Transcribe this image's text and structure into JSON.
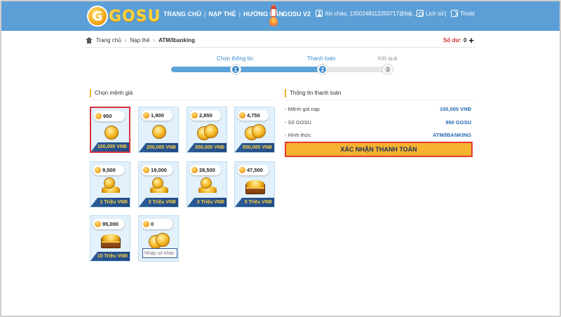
{
  "header": {
    "logo_text": "GOSU",
    "logo_letter": "G",
    "nav": [
      "TRANG CHỦ",
      "NẠP THẺ",
      "HƯỚNG DẪN"
    ],
    "nav_separator": "|",
    "v2_label": "GOSU V2",
    "greeting": "Xin chào, 1350248112250717@fac...",
    "history": "Lịch sử",
    "logout": "Thoát",
    "separator": "|"
  },
  "breadcrumb": {
    "items": [
      "Trang chủ",
      "Nạp thẻ",
      "ATM/Ibanking"
    ],
    "chevron": "›"
  },
  "balance": {
    "label": "Số dư:",
    "value": "0",
    "add": "+"
  },
  "steps": [
    {
      "label": "Chọn thông tin",
      "number": "1",
      "state": "active"
    },
    {
      "label": "Thanh toán",
      "number": "2",
      "state": "active"
    },
    {
      "label": "Kết quả",
      "number": "3",
      "state": "inactive"
    }
  ],
  "progress_fraction": 0.69,
  "denominations": {
    "title": "Chọn mệnh giá",
    "cards": [
      {
        "amount": "950",
        "price": "100,000 VNĐ",
        "art": "coin",
        "selected": true
      },
      {
        "amount": "1,900",
        "price": "200,000 VNĐ",
        "art": "coin"
      },
      {
        "amount": "2,850",
        "price": "300,000 VNĐ",
        "art": "coins"
      },
      {
        "amount": "4,750",
        "price": "500,000 VNĐ",
        "art": "coins"
      },
      {
        "amount": "9,500",
        "price": "1 Triệu VNĐ",
        "art": "pile"
      },
      {
        "amount": "19,000",
        "price": "2 Triệu VNĐ",
        "art": "pile"
      },
      {
        "amount": "28,500",
        "price": "3 Triệu VNĐ",
        "art": "pile"
      },
      {
        "amount": "47,500",
        "price": "5 Triệu VNĐ",
        "art": "chest"
      },
      {
        "amount": "95,000",
        "price": "10 Triệu VNĐ",
        "art": "chest"
      },
      {
        "amount": "0",
        "custom_placeholder": "Nhập số khác",
        "art": "coins"
      }
    ]
  },
  "payment": {
    "title": "Thông tin thanh toán",
    "rows": [
      {
        "label": "- Mệnh giá nạp",
        "value": "100,000 VNĐ"
      },
      {
        "label": "- Số GOSU",
        "value": "950 GOSU"
      },
      {
        "label": "- Hình thức",
        "value": "ATM/IBANKING"
      }
    ],
    "confirm_label": "XÁC NHẬN THANH TOÁN"
  },
  "colors": {
    "header_bg": "#5b9fd6",
    "accent_blue": "#3a8ccf",
    "price_bar": "#2d5a96",
    "confirm_bg": "#f6b330",
    "highlight_red": "#e23c32"
  }
}
